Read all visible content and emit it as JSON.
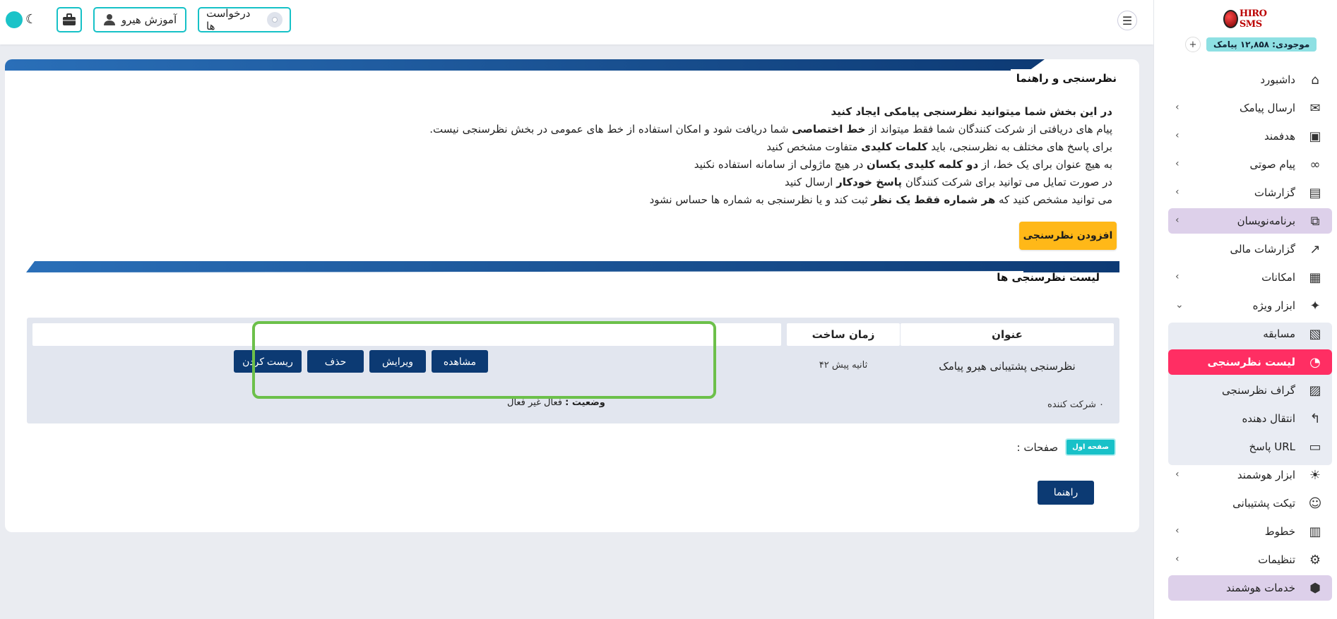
{
  "topbar": {
    "training_label": "آموزش هیرو",
    "requests_label": "درخواست ها",
    "theme_icon": "moon-icon",
    "colors": {
      "accent": "#16c1c7"
    }
  },
  "sidebar": {
    "logo_text": "HIRO SMS",
    "balance": "موجودی: ۱۲,۸۵۸ پیامک",
    "items": [
      {
        "label": "داشبورد",
        "icon": "home-icon",
        "chevron": false
      },
      {
        "label": "ارسال پیامک",
        "icon": "sms-icon",
        "chevron": true
      },
      {
        "label": "هدفمند",
        "icon": "message-icon",
        "chevron": true
      },
      {
        "label": "پیام صوتی",
        "icon": "voicemail-icon",
        "chevron": true
      },
      {
        "label": "گزارشات",
        "icon": "report-icon",
        "chevron": true
      },
      {
        "label": "برنامه‌نویسان",
        "icon": "code-icon",
        "chevron": true
      },
      {
        "label": "گزارشات مالی",
        "icon": "finance-chart-icon",
        "chevron": false
      },
      {
        "label": "امکانات",
        "icon": "tools-icon",
        "chevron": true
      },
      {
        "label": "ابزار ویژه",
        "icon": "sparkle-icon",
        "chevron": "down"
      },
      {
        "label": "مسابقه",
        "icon": "contest-icon",
        "chevron": false
      },
      {
        "label": "لیست نظرسنجی",
        "icon": "pie-chart-icon",
        "chevron": false
      },
      {
        "label": "گراف نظرسنجی",
        "icon": "graph-icon",
        "chevron": false
      },
      {
        "label": "انتقال دهنده",
        "icon": "transfer-icon",
        "chevron": false
      },
      {
        "label": "پاسخ URL",
        "icon": "card-icon",
        "chevron": false
      },
      {
        "label": "ابزار هوشمند",
        "icon": "bulb-icon",
        "chevron": true
      },
      {
        "label": "تیکت پشتیبانی",
        "icon": "support-icon",
        "chevron": false
      },
      {
        "label": "خطوط",
        "icon": "lines-icon",
        "chevron": true
      },
      {
        "label": "تنظیمات",
        "icon": "settings-icon",
        "chevron": true
      },
      {
        "label": "خدمات هوشمند",
        "icon": "box-icon",
        "chevron": false
      }
    ],
    "colors": {
      "active": "#ff2e63",
      "purple": "#ddd0ea"
    }
  },
  "main": {
    "title": "نظرسنجی و راهنما",
    "intro": {
      "lead": "در این بخش شما میتوانید نظرسنجی پیامکی ایجاد کنید",
      "line1_a": "پیام های دریافتی از شرکت کنندگان شما فقط میتواند از ",
      "line1_b": "خط اختصاصی",
      "line1_c": " شما دریافت شود و امکان استفاده از خط های عمومی در بخش نظرسنجی نیست.",
      "line2_a": "برای پاسخ های مختلف به نظرسنجی، باید ",
      "line2_b": "کلمات کلیدی",
      "line2_c": " متفاوت مشخص کنید",
      "line3_a": "به هیچ عنوان برای یک خط، از ",
      "line3_b": "دو کلمه کلیدی یکسان",
      "line3_c": " در هیچ ماژولی از سامانه استفاده نکنید",
      "line4_a": "در صورت تمایل می توانید برای شرکت کنندگان ",
      "line4_b": "پاسخ خودکار",
      "line4_c": " ارسال کنید",
      "line5_a": "می توانید مشخص کنید که ",
      "line5_b": "هر شماره فقط یک نظر",
      "line5_c": " ثبت کند و یا نظرسنجی به شماره ها حساس نشود"
    },
    "add_button": "افزودن نظرسنجی",
    "list_title": "لیست نظرسنجی ها",
    "table": {
      "headers": {
        "title": "عنوان",
        "created": "زمان ساخت",
        "actions": ""
      },
      "rows": [
        {
          "title": "نظرسنجی پشتیبانی هیرو پیامک",
          "created": "۴۲ ثانیه پیش",
          "actions": [
            "مشاهده",
            "ویرایش",
            "حذف",
            "ریست کردن"
          ],
          "participants": "۰ شرکت کننده",
          "status_label": "وضعیت :",
          "status_value": "فعال غیر فعال"
        }
      ]
    },
    "pages_label": "صفحات :",
    "first_page": "صفحه اول",
    "guide_button": "راهنما",
    "colors": {
      "primary": "#0c3a73",
      "warning": "#ffb818",
      "highlight": "#6cc04a"
    }
  }
}
